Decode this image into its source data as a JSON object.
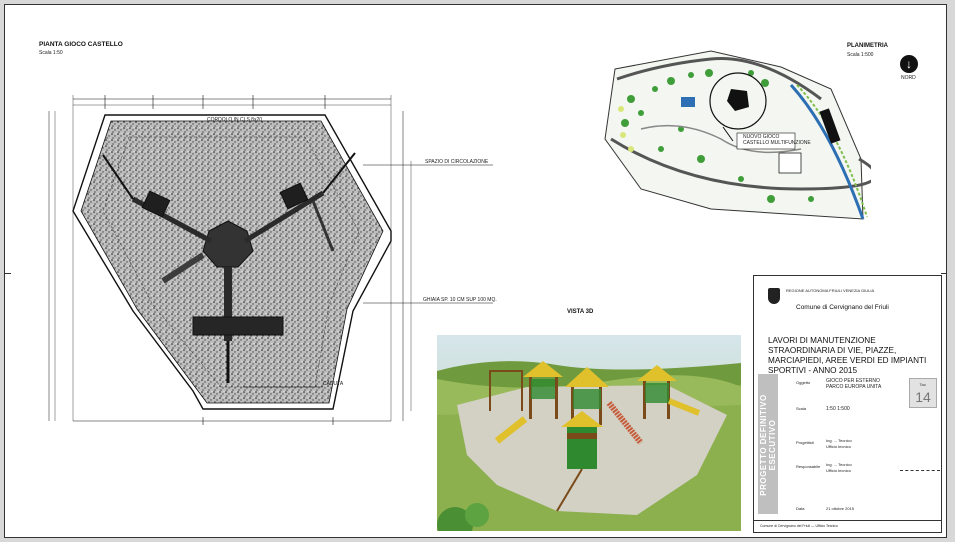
{
  "plan": {
    "title": "PIANTA GIOCO CASTELLO",
    "scale": "Scala 1:50",
    "labels": {
      "concrete_curb": "CORDOLO IN CLS 8x20",
      "circulation": "SPAZIO DI CIRCOLAZIONE",
      "gravel": "GHIAIA SP. 10 CM SUP 100 MQ.",
      "fall": "CADUTA"
    }
  },
  "site_plan": {
    "title": "PLANIMETRIA",
    "scale": "Scala 1:500",
    "callout": "NUOVO GIOCO\nCASTELLO MULTIFUNZIONE",
    "north_label": "NORD"
  },
  "view3d": {
    "title": "VISTA 3D"
  },
  "title_block": {
    "region_lines": "REGIONE AUTONOMA FRIULI VENEZIA GIULIA",
    "municipality": "Comune di Cervignano del Friuli",
    "project_title": "LAVORI DI MANUTENZIONE STRAORDINARIA DI VIE, PIAZZE, MARCIAPIEDI, AREE VERDI ED IMPIANTI SPORTIVI - ANNO 2015",
    "phase": "PROGETTO DEFINITIVO ESECUTIVO",
    "object_label": "Oggetto",
    "object_value": "GIOCO PER ESTERNO\nPARCO EUROPA UNITA",
    "scale_label": "Scala",
    "scale_value": "1:50 1:500",
    "designer_label": "Progettisti",
    "designer_value": "Ing. ... Tecnico\nUfficio tecnico",
    "manager_label": "Responsabile",
    "manager_value": "Ing. ... Tecnico\nUfficio tecnico",
    "date_label": "Data",
    "date_value": "21 ottobre 2015",
    "sheet_label": "Tav.",
    "sheet_number": "14",
    "footer": "Comune di Cervignano del Friuli — Ufficio Tecnico"
  }
}
